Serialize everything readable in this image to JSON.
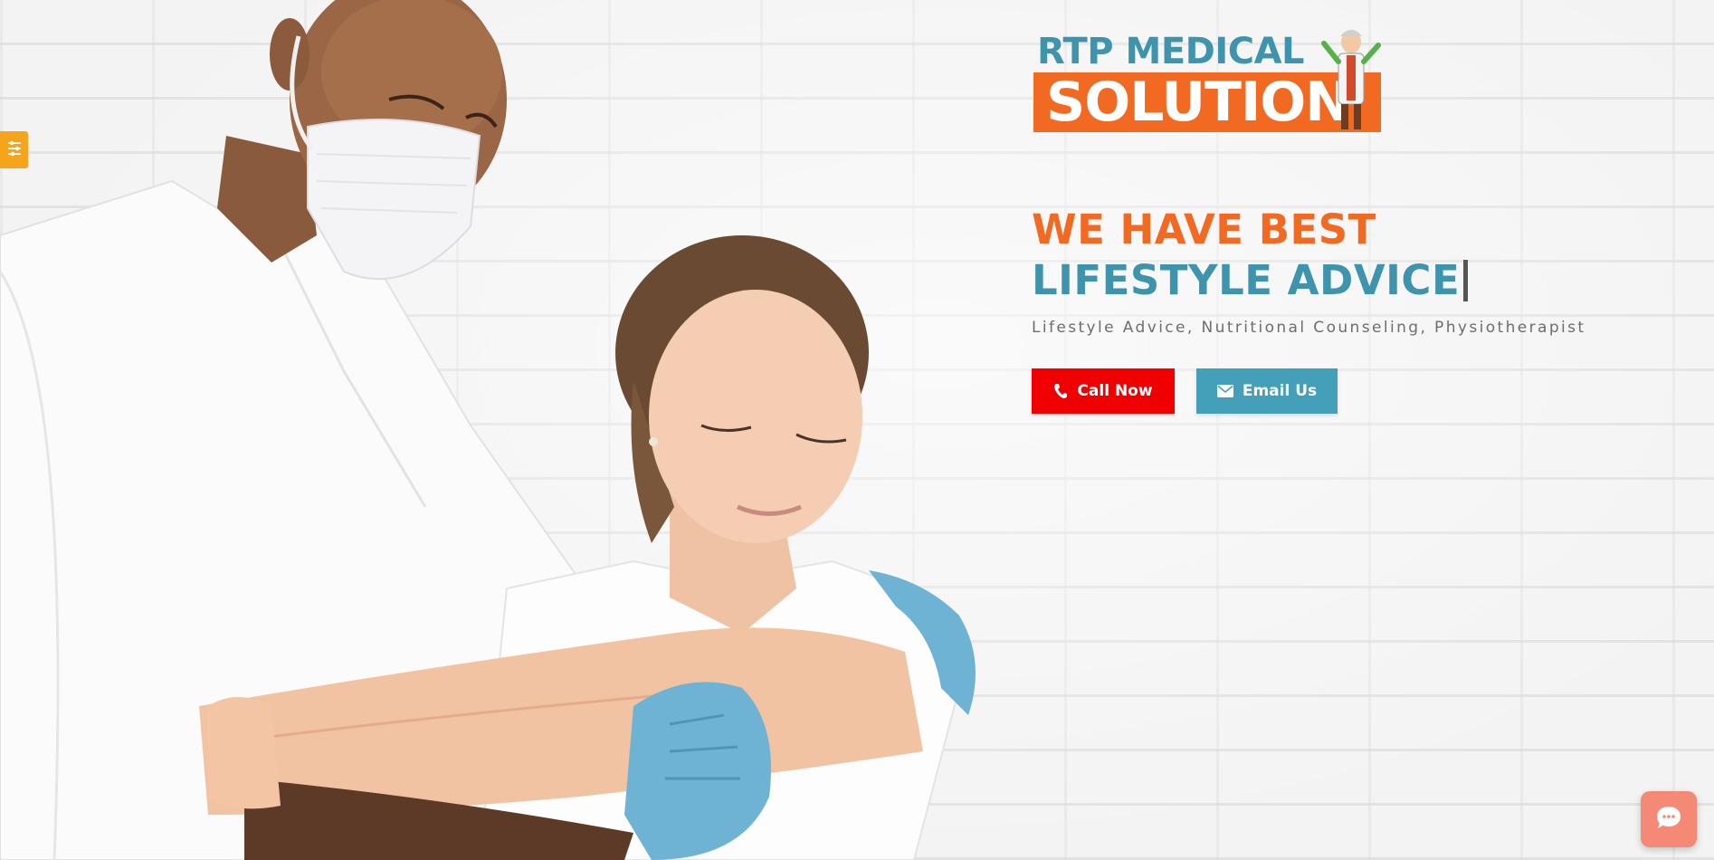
{
  "brand": {
    "logo_line1": "RTP MEDICAL",
    "logo_line2": "SOLUTION"
  },
  "hero": {
    "headline_line1": "WE HAVE BEST",
    "headline_line2": "LIFESTYLE ADVICE",
    "subtitle": "Lifestyle Advice, Nutritional Counseling, Physiotherapist"
  },
  "actions": {
    "call_label": "Call Now",
    "email_label": "Email Us"
  },
  "icons": {
    "side_tab": "sliders-icon",
    "call": "phone-icon",
    "email": "envelope-icon",
    "chat": "chat-bubble-icon"
  },
  "colors": {
    "accent_orange": "#f26a22",
    "accent_teal": "#3f94ad",
    "call_button": "#f00000",
    "email_button": "#44a0b8",
    "side_tab": "#f7a41d",
    "chat_button": "#f48a76"
  }
}
